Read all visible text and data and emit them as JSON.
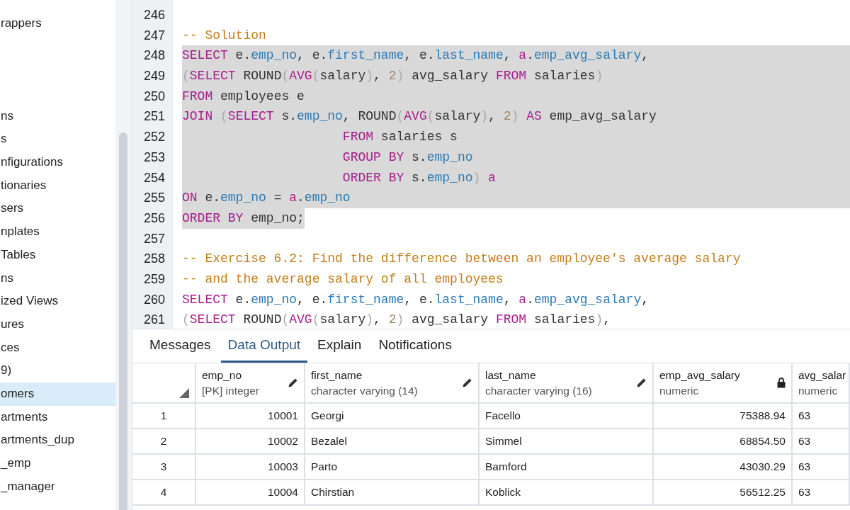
{
  "sidebar": {
    "items": [
      {
        "label": "rappers",
        "selected": false
      },
      {
        "label": "ns",
        "selected": false
      },
      {
        "label": "s",
        "selected": false
      },
      {
        "label": "nfigurations",
        "selected": false
      },
      {
        "label": "tionaries",
        "selected": false
      },
      {
        "label": "sers",
        "selected": false
      },
      {
        "label": "nplates",
        "selected": false
      },
      {
        "label": "Tables",
        "selected": false
      },
      {
        "label": "ns",
        "selected": false
      },
      {
        "label": "ized Views",
        "selected": false
      },
      {
        "label": "ures",
        "selected": false
      },
      {
        "label": "ces",
        "selected": false
      },
      {
        "label": "9)",
        "selected": false
      },
      {
        "label": "omers",
        "selected": true
      },
      {
        "label": "artments",
        "selected": false
      },
      {
        "label": "artments_dup",
        "selected": false
      },
      {
        "label": "_emp",
        "selected": false
      },
      {
        "label": "_manager",
        "selected": false
      }
    ]
  },
  "editor": {
    "lines": [
      {
        "number": "246"
      },
      {
        "number": "247",
        "selected": false,
        "tokens": [
          {
            "kind": "comment",
            "text": "-- Solution"
          }
        ]
      },
      {
        "number": "248",
        "selected": true,
        "tokens": [
          {
            "kind": "keyword",
            "text": "SELECT"
          },
          {
            "kind": "plain",
            "text": " e."
          },
          {
            "kind": "field",
            "text": "emp_no"
          },
          {
            "kind": "plain",
            "text": ", e."
          },
          {
            "kind": "field",
            "text": "first_name"
          },
          {
            "kind": "plain",
            "text": ", e."
          },
          {
            "kind": "field",
            "text": "last_name"
          },
          {
            "kind": "plain",
            "text": ", "
          },
          {
            "kind": "keyword",
            "text": "a"
          },
          {
            "kind": "plain",
            "text": "."
          },
          {
            "kind": "field",
            "text": "emp_avg_salary"
          },
          {
            "kind": "plain",
            "text": ","
          }
        ]
      },
      {
        "number": "249",
        "selected": true,
        "tokens": [
          {
            "kind": "punct",
            "text": "("
          },
          {
            "kind": "keyword",
            "text": "SELECT"
          },
          {
            "kind": "plain",
            "text": " ROUND"
          },
          {
            "kind": "punct",
            "text": "("
          },
          {
            "kind": "keyword",
            "text": "AVG"
          },
          {
            "kind": "punct",
            "text": "("
          },
          {
            "kind": "plain",
            "text": "salary"
          },
          {
            "kind": "punct",
            "text": ")"
          },
          {
            "kind": "plain",
            "text": ", "
          },
          {
            "kind": "number",
            "text": "2"
          },
          {
            "kind": "punct",
            "text": ")"
          },
          {
            "kind": "plain",
            "text": " avg_salary "
          },
          {
            "kind": "keyword",
            "text": "FROM"
          },
          {
            "kind": "plain",
            "text": " salaries"
          },
          {
            "kind": "punct",
            "text": ")"
          }
        ]
      },
      {
        "number": "250",
        "selected": true,
        "tokens": [
          {
            "kind": "keyword",
            "text": "FROM"
          },
          {
            "kind": "plain",
            "text": " employees e"
          }
        ]
      },
      {
        "number": "251",
        "selected": true,
        "tokens": [
          {
            "kind": "keyword",
            "text": "JOIN "
          },
          {
            "kind": "punct",
            "text": "("
          },
          {
            "kind": "keyword",
            "text": "SELECT"
          },
          {
            "kind": "plain",
            "text": " s."
          },
          {
            "kind": "field",
            "text": "emp_no"
          },
          {
            "kind": "plain",
            "text": ", ROUND"
          },
          {
            "kind": "punct",
            "text": "("
          },
          {
            "kind": "keyword",
            "text": "AVG"
          },
          {
            "kind": "punct",
            "text": "("
          },
          {
            "kind": "plain",
            "text": "salary"
          },
          {
            "kind": "punct",
            "text": ")"
          },
          {
            "kind": "plain",
            "text": ", "
          },
          {
            "kind": "number",
            "text": "2"
          },
          {
            "kind": "punct",
            "text": ")"
          },
          {
            "kind": "keyword",
            "text": " AS"
          },
          {
            "kind": "plain",
            "text": " emp_avg_salary"
          }
        ]
      },
      {
        "number": "252",
        "selected": true,
        "tokens": [
          {
            "kind": "keyword",
            "text": "                     FROM"
          },
          {
            "kind": "plain",
            "text": " salaries s"
          }
        ]
      },
      {
        "number": "253",
        "selected": true,
        "tokens": [
          {
            "kind": "keyword",
            "text": "                     GROUP BY"
          },
          {
            "kind": "plain",
            "text": " s."
          },
          {
            "kind": "field",
            "text": "emp_no"
          }
        ]
      },
      {
        "number": "254",
        "selected": true,
        "tokens": [
          {
            "kind": "keyword",
            "text": "                     ORDER BY"
          },
          {
            "kind": "plain",
            "text": " s."
          },
          {
            "kind": "field",
            "text": "emp_no"
          },
          {
            "kind": "punct",
            "text": ")"
          },
          {
            "kind": "keyword",
            "text": " a"
          }
        ]
      },
      {
        "number": "255",
        "selected": true,
        "tokens": [
          {
            "kind": "keyword",
            "text": "ON"
          },
          {
            "kind": "plain",
            "text": " e."
          },
          {
            "kind": "field",
            "text": "emp_no"
          },
          {
            "kind": "plain",
            "text": " = "
          },
          {
            "kind": "keyword",
            "text": "a"
          },
          {
            "kind": "plain",
            "text": "."
          },
          {
            "kind": "field",
            "text": "emp_no"
          }
        ]
      },
      {
        "number": "256",
        "selected": true,
        "tokens": [
          {
            "kind": "keyword",
            "text": "ORDER BY"
          },
          {
            "kind": "plain",
            "text": " emp_no;"
          }
        ]
      },
      {
        "number": "257"
      },
      {
        "number": "258",
        "selected": false,
        "tokens": [
          {
            "kind": "comment",
            "text": "-- Exercise 6.2: Find the difference between an employee's average salary"
          }
        ]
      },
      {
        "number": "259",
        "selected": false,
        "tokens": [
          {
            "kind": "comment",
            "text": "-- and the average salary of all employees"
          }
        ]
      },
      {
        "number": "260",
        "selected": false,
        "tokens": [
          {
            "kind": "keyword",
            "text": "SELECT"
          },
          {
            "kind": "plain",
            "text": " e."
          },
          {
            "kind": "field",
            "text": "emp_no"
          },
          {
            "kind": "plain",
            "text": ", e."
          },
          {
            "kind": "field",
            "text": "first_name"
          },
          {
            "kind": "plain",
            "text": ", e."
          },
          {
            "kind": "field",
            "text": "last_name"
          },
          {
            "kind": "plain",
            "text": ", "
          },
          {
            "kind": "keyword",
            "text": "a"
          },
          {
            "kind": "plain",
            "text": "."
          },
          {
            "kind": "field",
            "text": "emp_avg_salary"
          },
          {
            "kind": "plain",
            "text": ","
          }
        ]
      },
      {
        "number": "261",
        "selected": false,
        "tokens": [
          {
            "kind": "punct",
            "text": "("
          },
          {
            "kind": "keyword",
            "text": "SELECT"
          },
          {
            "kind": "plain",
            "text": " ROUND"
          },
          {
            "kind": "punct",
            "text": "("
          },
          {
            "kind": "keyword",
            "text": "AVG"
          },
          {
            "kind": "punct",
            "text": "("
          },
          {
            "kind": "plain",
            "text": "salary"
          },
          {
            "kind": "punct",
            "text": ")"
          },
          {
            "kind": "plain",
            "text": ", "
          },
          {
            "kind": "number",
            "text": "2"
          },
          {
            "kind": "punct",
            "text": ")"
          },
          {
            "kind": "plain",
            "text": " avg_salary "
          },
          {
            "kind": "keyword",
            "text": "FROM"
          },
          {
            "kind": "plain",
            "text": " salaries"
          },
          {
            "kind": "punct",
            "text": ")"
          },
          {
            "kind": "plain",
            "text": ","
          }
        ]
      }
    ]
  },
  "tabs": [
    {
      "label": "Messages",
      "selected": false
    },
    {
      "label": "Data Output",
      "selected": true
    },
    {
      "label": "Explain",
      "selected": false
    },
    {
      "label": "Notifications",
      "selected": false
    }
  ],
  "table": {
    "columns": [
      {
        "name": "emp_no",
        "type": "[PK] integer",
        "editable": true,
        "kind": "number"
      },
      {
        "name": "first_name",
        "type": "character varying (14)",
        "editable": true,
        "kind": "text"
      },
      {
        "name": "last_name",
        "type": "character varying (16)",
        "editable": true,
        "kind": "text"
      },
      {
        "name": "emp_avg_salary",
        "type": "numeric",
        "editable": false,
        "kind": "number"
      },
      {
        "name": "avg_salar",
        "type": "numeric",
        "kind": "text"
      }
    ],
    "rows": [
      {
        "number": "1",
        "cells": [
          "10001",
          "Georgi",
          "Facello",
          "75388.94",
          "63"
        ]
      },
      {
        "number": "2",
        "cells": [
          "10002",
          "Bezalel",
          "Simmel",
          "68854.50",
          "63"
        ]
      },
      {
        "number": "3",
        "cells": [
          "10003",
          "Parto",
          "Bamford",
          "43030.29",
          "63"
        ]
      },
      {
        "number": "4",
        "cells": [
          "10004",
          "Chirstian",
          "Koblick",
          "56512.25",
          "63"
        ]
      }
    ]
  }
}
